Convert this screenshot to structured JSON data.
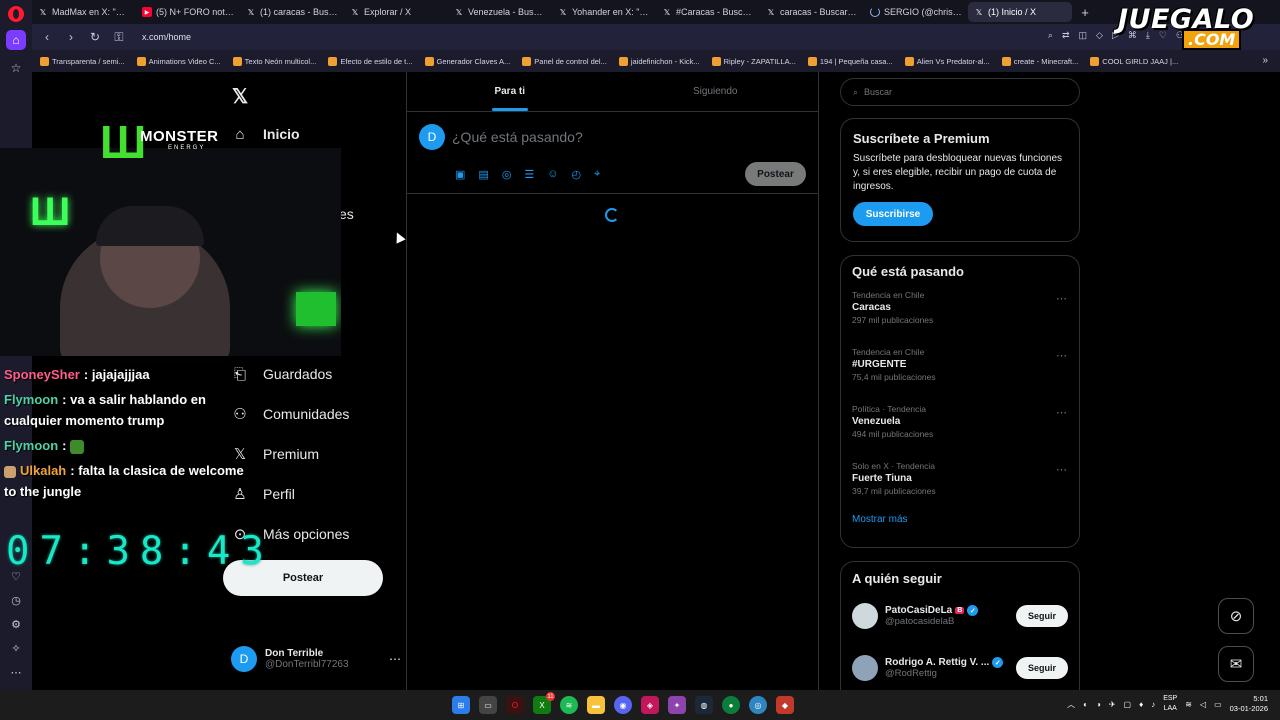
{
  "browser": {
    "tabs": [
      {
        "title": "MadMax en X: \"Venez...",
        "icon": "x-icon",
        "fav": "𝕏"
      },
      {
        "title": "(5) N+ FORO noticias en v...",
        "icon": "youtube-icon",
        "fav": "▶"
      },
      {
        "title": "(1) caracas - Buscar / X",
        "icon": "x-icon",
        "fav": "𝕏"
      },
      {
        "title": "Explorar / X",
        "icon": "x-icon",
        "fav": "𝕏"
      },
      {
        "title": "Venezuela - Buscar / X",
        "icon": "x-icon",
        "fav": "𝕏"
      },
      {
        "title": "Yohander en X: \"#Últimah...",
        "icon": "x-icon",
        "fav": "𝕏"
      },
      {
        "title": "#Caracas - Buscar / X",
        "icon": "x-icon",
        "fav": "𝕏"
      },
      {
        "title": "caracas - Buscar / X",
        "icon": "x-icon",
        "fav": "𝕏"
      },
      {
        "title": "SERGIO (@christopher14...",
        "icon": "loading-icon",
        "fav": ""
      },
      {
        "title": "(1) Inicio / X",
        "icon": "x-icon",
        "fav": "𝕏",
        "active": true
      }
    ],
    "url": "x.com/home",
    "bookmarks": [
      "Transparenta / semi...",
      "Animations Video C...",
      "Texto Neón multicol...",
      "Efecto de estilo de t...",
      "Generador Claves A...",
      "Panel de control del...",
      "jaidefinichon - Kick...",
      "Ripley - ZAPATILLA...",
      "194 | Pequeña casa...",
      "Alien Vs Predator-al...",
      "create - Minecraft...",
      "COOL GIRLD JAAJ |..."
    ]
  },
  "watermark": {
    "top": "JUEGALO",
    "bottom": ".COM"
  },
  "x": {
    "nav": [
      {
        "label": "Inicio",
        "icon": "home-icon"
      },
      {
        "label": "es",
        "icon": ""
      },
      {
        "label": "Guardados",
        "icon": "bookmark-icon"
      },
      {
        "label": "Comunidades",
        "icon": "communities-icon"
      },
      {
        "label": "Premium",
        "icon": "x-icon"
      },
      {
        "label": "Perfil",
        "icon": "person-icon"
      },
      {
        "label": "Más opciones",
        "icon": "more-circle-icon"
      }
    ],
    "post_button": "Postear",
    "profile": {
      "avatar_letter": "D",
      "name": "Don Terrible",
      "handle": "@DonTerribl77263"
    },
    "timeline": {
      "tabs": [
        "Para ti",
        "Siguiendo"
      ],
      "composer_placeholder": "¿Qué está pasando?",
      "composer_avatar": "D",
      "post_button": "Postear"
    },
    "search_placeholder": "Buscar",
    "premium": {
      "title": "Suscríbete a Premium",
      "text": "Suscríbete para desbloquear nuevas funciones y, si eres elegible, recibir un pago de cuota de ingresos.",
      "button": "Suscribirse"
    },
    "trends": {
      "title": "Qué está pasando",
      "items": [
        {
          "meta": "Tendencia en Chile",
          "name": "Caracas",
          "count": "297 mil publicaciones"
        },
        {
          "meta": "Tendencia en Chile",
          "name": "#URGENTE",
          "count": "75,4 mil publicaciones"
        },
        {
          "meta": "Política · Tendencia",
          "name": "Venezuela",
          "count": "494 mil publicaciones"
        },
        {
          "meta": "Solo en X · Tendencia",
          "name": "Fuerte Tiuna",
          "count": "39,7 mil publicaciones"
        }
      ],
      "show_more": "Mostrar más"
    },
    "who_to_follow": {
      "title": "A quién seguir",
      "users": [
        {
          "name": "PatoCasiDeLa",
          "badge": "B",
          "handle": "@patocasidelaB",
          "button": "Seguir"
        },
        {
          "name": "Rodrigo A. Rettig V. ...",
          "handle": "@RodRettig",
          "button": "Seguir"
        }
      ]
    }
  },
  "stream_overlay": {
    "chat": [
      {
        "user": "SponeySher",
        "color": "#ff5c8a",
        "message": "jajajajjjaa"
      },
      {
        "user": "Flymoon",
        "color": "#4fd1a5",
        "message": "va a salir hablando en cualquier momento trump"
      },
      {
        "user": "Flymoon",
        "color": "#4fd1a5",
        "message": ""
      },
      {
        "user": "Ulkalah",
        "color": "#f0a33a",
        "message": "falta la clasica de welcome to the jungle"
      }
    ],
    "timer": "07:38:43",
    "sponsor": {
      "brand": "MONSTER",
      "sub": "ENERGY"
    }
  },
  "taskbar": {
    "lang_top": "ESP",
    "lang_bottom": "LAA",
    "time": "5:01",
    "date": "03-01-2026",
    "badge_count": "11"
  }
}
